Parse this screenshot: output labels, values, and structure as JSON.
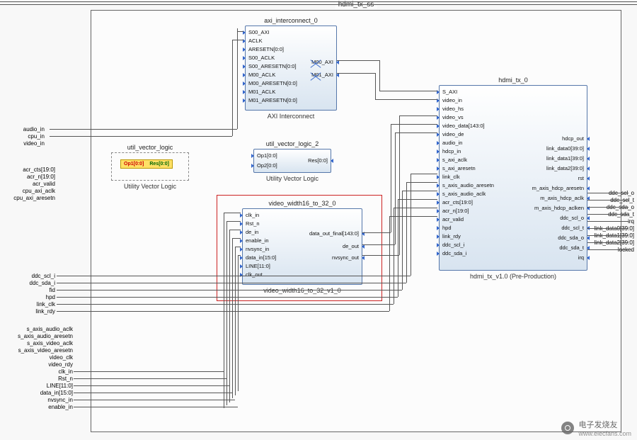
{
  "diagram": {
    "top_hierarchy_title": "hdmi_tx_ss"
  },
  "axi_interconnect": {
    "title": "axi_interconnect_0",
    "caption": "AXI Interconnect",
    "ports_left": [
      "S00_AXI",
      "ACLK",
      "ARESETN[0:0]",
      "S00_ACLK",
      "S00_ARESETN[0:0]",
      "M00_ACLK",
      "M00_ARESETN[0:0]",
      "M01_ACLK",
      "M01_ARESETN[0:0]"
    ],
    "ports_right": [
      "M00_AXI",
      "M01_AXI"
    ]
  },
  "util_vector_logic": {
    "title": "util_vector_logic_2",
    "caption": "Utility Vector Logic",
    "ports_left": [
      "Op1[0:0]",
      "Op2[0:0]"
    ],
    "ports_right": [
      "Res[0:0]"
    ],
    "small_block_caption": "Utility Vector Logic",
    "small_block_title": "util_vector_logic",
    "small_op1": "Op1[0:0]",
    "small_res": "Res[0:0]"
  },
  "video_width": {
    "title": "video_width16_to_32_0",
    "caption": "video_width16_to_32_v1_0",
    "ports_left": [
      "clk_in",
      "Rst_n",
      "de_in",
      "enable_in",
      "nvsync_in",
      "data_in[15:0]",
      "LINE[11:0]",
      "clk_out"
    ],
    "ports_right": [
      "data_out_final[143:0]",
      "de_out",
      "nvsync_out"
    ]
  },
  "hdmi_tx": {
    "title": "hdmi_tx_0",
    "caption": "hdmi_tx_v1.0 (Pre-Production)",
    "ports_left": [
      "S_AXI",
      "video_in",
      "video_hs",
      "video_vs",
      "video_data[143:0]",
      "video_de",
      "audio_in",
      "hdcp_in",
      "s_axi_aclk",
      "s_axi_aresetn",
      "link_clk",
      "s_axis_audio_aresetn",
      "s_axis_audio_aclk",
      "acr_cts[19:0]",
      "acr_n[19:0]",
      "acr_valid",
      "hpd",
      "link_rdy",
      "ddc_scl_i",
      "ddc_sda_i"
    ],
    "ports_right": [
      "hdcp_out",
      "link_data0[39:0]",
      "link_data1[39:0]",
      "link_data2[39:0]",
      "rst",
      "m_axis_hdcp_aresetn",
      "m_axis_hdcp_aclk",
      "m_axis_hdcp_aclken",
      "ddc_scl_o",
      "ddc_scl_t",
      "ddc_sda_o",
      "ddc_sda_t",
      "irq"
    ]
  },
  "ext_ports_left_upper": [
    "audio_in",
    "cpu_in",
    "video_in"
  ],
  "ext_ports_left_acr": [
    "acr_cts[19:0]",
    "acr_n[19:0]",
    "acr_valid",
    "cpu_axi_aclk",
    "cpu_axi_aresetn"
  ],
  "ext_ports_left_mid": [
    "ddc_scl_i",
    "ddc_sda_i",
    "fid",
    "hpd",
    "link_clk",
    "link_rdy"
  ],
  "ext_ports_left_lower": [
    "s_axis_audio_aclk",
    "s_axis_audio_aresetn",
    "s_axis_video_aclk",
    "s_axis_video_aresetn",
    "video_clk",
    "video_rdy",
    "clk_in",
    "Rst_n",
    "LINE[11:0]",
    "data_in[15:0]",
    "nvsync_in",
    "enable_in"
  ],
  "ext_ports_right": [
    "ddc_scl_o",
    "ddc_scl_t",
    "ddc_sda_o",
    "ddc_sda_t",
    "irq",
    "link_data0[39:0]",
    "link_data1[39:0]",
    "link_data2[39:0]",
    "locked"
  ],
  "watermark": {
    "text": "电子发烧友",
    "url": "www.elecfans.com"
  }
}
